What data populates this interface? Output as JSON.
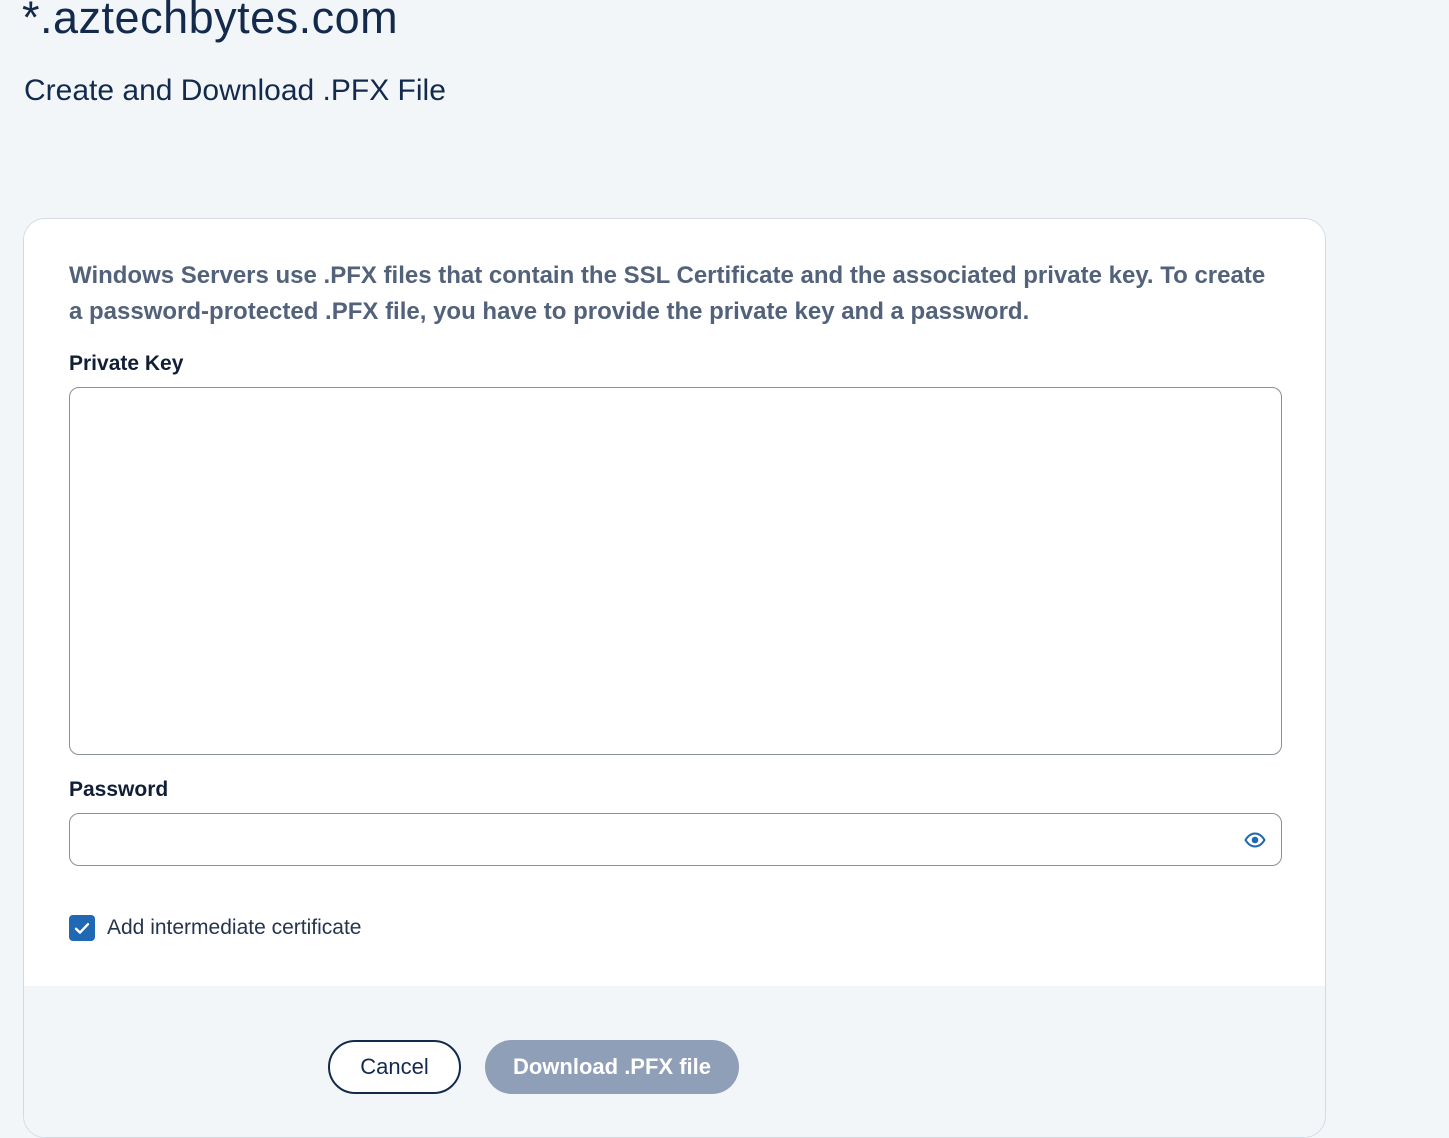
{
  "header": {
    "domain": "*.aztechbytes.com",
    "subtitle": "Create and Download .PFX File"
  },
  "form": {
    "description": "Windows Servers use .PFX files that contain the SSL Certificate and the associated private key. To create a password-protected .PFX file, you have to provide the private key and a password.",
    "private_key_label": "Private Key",
    "private_key_value": "",
    "password_label": "Password",
    "password_value": "",
    "password_icon": "eye-icon",
    "intermediate_checkbox_label": "Add intermediate certificate",
    "intermediate_checked": true
  },
  "footer": {
    "cancel_label": "Cancel",
    "download_label": "Download .PFX file"
  },
  "colors": {
    "brand_dark": "#132a4c",
    "checkbox_blue": "#1f68b4",
    "disabled_button": "#8f9fb7",
    "page_background": "#f3f6f9"
  }
}
